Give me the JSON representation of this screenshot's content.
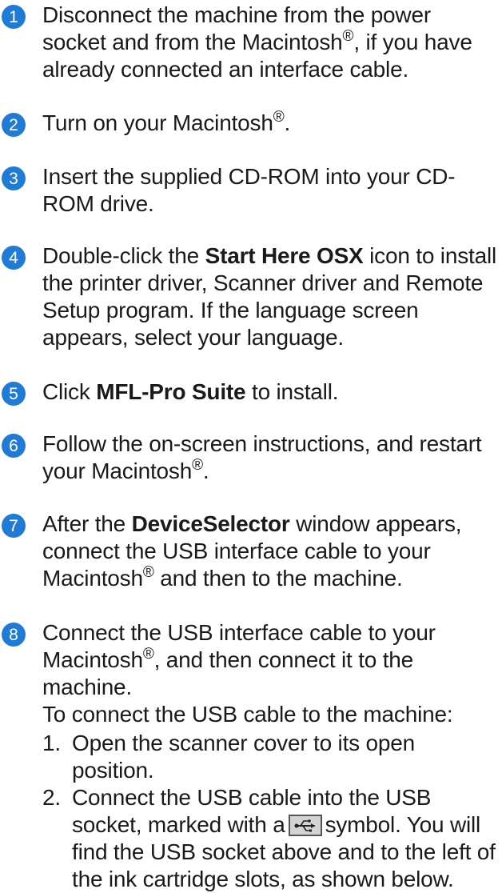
{
  "steps": [
    {
      "number": "1",
      "text_a": "Disconnect the machine from the power socket and from the Macintosh",
      "sup": "®",
      "text_b": ", if you have already connected an interface cable."
    },
    {
      "number": "2",
      "text_a": "Turn on your Macintosh",
      "sup": "®",
      "text_b": "."
    },
    {
      "number": "3",
      "text_a": "Insert the supplied CD-ROM into your CD-ROM drive."
    },
    {
      "number": "4",
      "text_a": "Double-click the ",
      "bold": "Start Here OSX",
      "text_b": " icon to install the printer driver, Scanner driver and Remote Setup program. If the language screen appears, select your language."
    },
    {
      "number": "5",
      "text_a": "Click ",
      "bold": "MFL-Pro Suite",
      "text_b": " to install."
    },
    {
      "number": "6",
      "text_a": "Follow the on-screen instructions, and restart your Macintosh",
      "sup": "®",
      "text_b": "."
    },
    {
      "number": "7",
      "text_a": "After the ",
      "bold": "DeviceSelector",
      "text_b": " window appears, connect the USB interface cable to your Macintosh",
      "sup": "®",
      "text_c": " and then to the machine."
    },
    {
      "number": "8",
      "text_a": "Connect the USB interface cable to your Macintosh",
      "sup": "®",
      "text_b": ", and then connect it to the machine.",
      "text_c": "To connect the USB cable to the machine:"
    }
  ],
  "substeps": [
    {
      "label": "1.",
      "text": "Open the scanner cover to its open position."
    },
    {
      "label": "2.",
      "text_a": "Connect the USB cable into the USB socket, marked with a",
      "text_b": "symbol. You will find the USB socket above and to the left of the ink cartridge slots, as shown below."
    }
  ],
  "icons": {
    "usb_symbol": "usb-icon"
  },
  "colors": {
    "step_circle": "#1f7bd6"
  }
}
